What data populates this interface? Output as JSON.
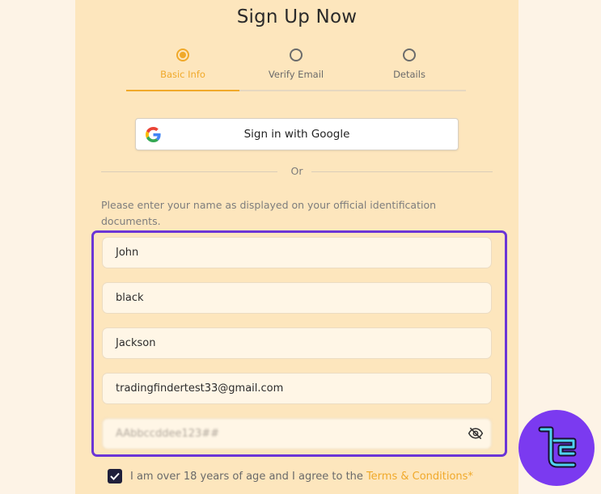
{
  "signup": {
    "title": "Sign Up Now",
    "steps": [
      {
        "label": "Basic Info",
        "active": true
      },
      {
        "label": "Verify Email",
        "active": false
      },
      {
        "label": "Details",
        "active": false
      }
    ],
    "google_button_label": "Sign in with Google",
    "divider_text": "Or",
    "name_hint": "Please enter your name as displayed on your official identification documents.",
    "fields": {
      "first_name": "John",
      "middle_name": "black",
      "last_name": "Jackson",
      "email": "tradingfindertest33@gmail.com",
      "password_masked": "AAbbccddee123##"
    },
    "agree_text": "I am over 18 years of age and I agree to the",
    "terms_link": "Terms & Conditions*"
  },
  "colors": {
    "page_bg": "#fdf3e6",
    "card_bg": "#fde6bd",
    "accent": "#f0a92a",
    "highlight_frame": "#6b35d6",
    "badge_bg": "#7b3af0",
    "badge_glyph": "#4fd3f0"
  },
  "icons": {
    "google": "google-g-icon",
    "password_toggle": "eye-slash-icon",
    "checkbox": "checkmark-icon",
    "badge": "tf-logo-icon"
  }
}
